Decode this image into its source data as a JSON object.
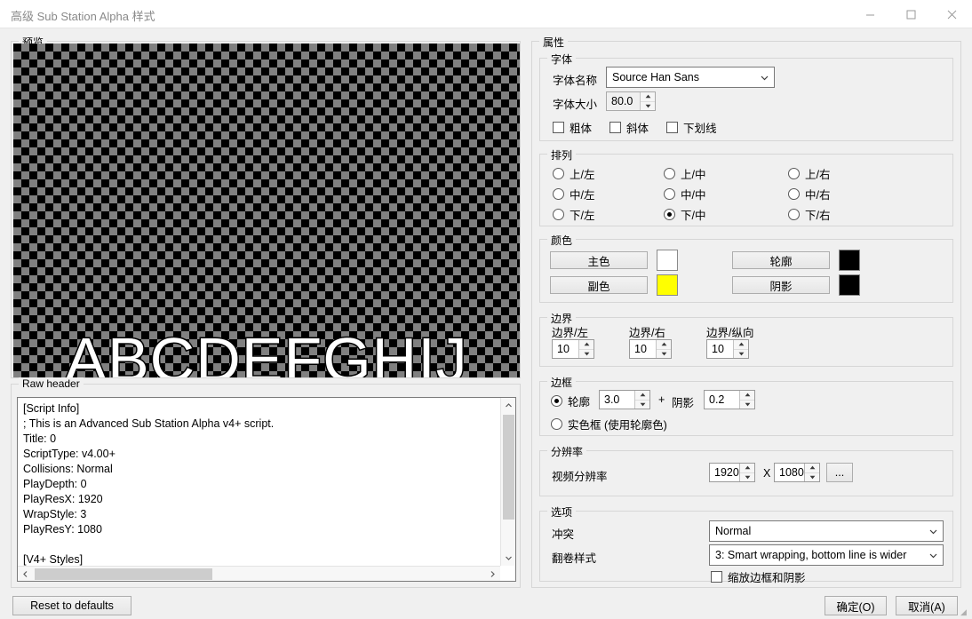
{
  "window": {
    "title": "高级 Sub Station Alpha 样式",
    "minimize_icon": "minimize-icon",
    "maximize_icon": "maximize-icon",
    "close_icon": "close-icon"
  },
  "preview": {
    "label": "预览",
    "sample_text": "ABCDEFGHIJ"
  },
  "raw_header": {
    "label": "Raw header",
    "content": "[Script Info]\n; This is an Advanced Sub Station Alpha v4+ script.\nTitle: 0\nScriptType: v4.00+\nCollisions: Normal\nPlayDepth: 0\nPlayResX: 1920\nWrapStyle: 3\nPlayResY: 1080\n\n[V4+ Styles]"
  },
  "properties": {
    "label": "属性",
    "font": {
      "label": "字体",
      "name_label": "字体名称",
      "name_value": "Source Han Sans",
      "size_label": "字体大小",
      "size_value": "80.0",
      "bold_label": "粗体",
      "italic_label": "斜体",
      "underline_label": "下划线"
    },
    "alignment": {
      "label": "排列",
      "options": [
        "上/左",
        "上/中",
        "上/右",
        "中/左",
        "中/中",
        "中/右",
        "下/左",
        "下/中",
        "下/右"
      ],
      "selected": "下/中"
    },
    "colors": {
      "label": "颜色",
      "primary_label": "主色",
      "primary_color": "#ffffff",
      "secondary_label": "副色",
      "secondary_color": "#ffff00",
      "outline_label": "轮廓",
      "outline_color": "#000000",
      "shadow_label": "阴影",
      "shadow_color": "#000000"
    },
    "margins": {
      "label": "边界",
      "left_label": "边界/左",
      "left_value": "10",
      "right_label": "边界/右",
      "right_value": "10",
      "vertical_label": "边界/纵向",
      "vertical_value": "10"
    },
    "border": {
      "label": "边框",
      "outline_label": "轮廓",
      "outline_value": "3.0",
      "plus_label": "+",
      "shadow_label": "阴影",
      "shadow_value": "0.2",
      "opaque_box_label": "实色框 (使用轮廓色)",
      "selected": "轮廓"
    },
    "resolution": {
      "label": "分辨率",
      "video_label": "视频分辨率",
      "width": "1920",
      "separator": "X",
      "height": "1080",
      "browse_label": "..."
    },
    "options": {
      "label": "选项",
      "collision_label": "冲突",
      "collision_value": "Normal",
      "wrapstyle_label": "翻卷样式",
      "wrapstyle_value": "3: Smart wrapping, bottom line is wider",
      "scale_border_label": "缩放边框和阴影"
    }
  },
  "footer": {
    "reset_label": "Reset to defaults",
    "ok_label": "确定(O)",
    "cancel_label": "取消(A)"
  }
}
